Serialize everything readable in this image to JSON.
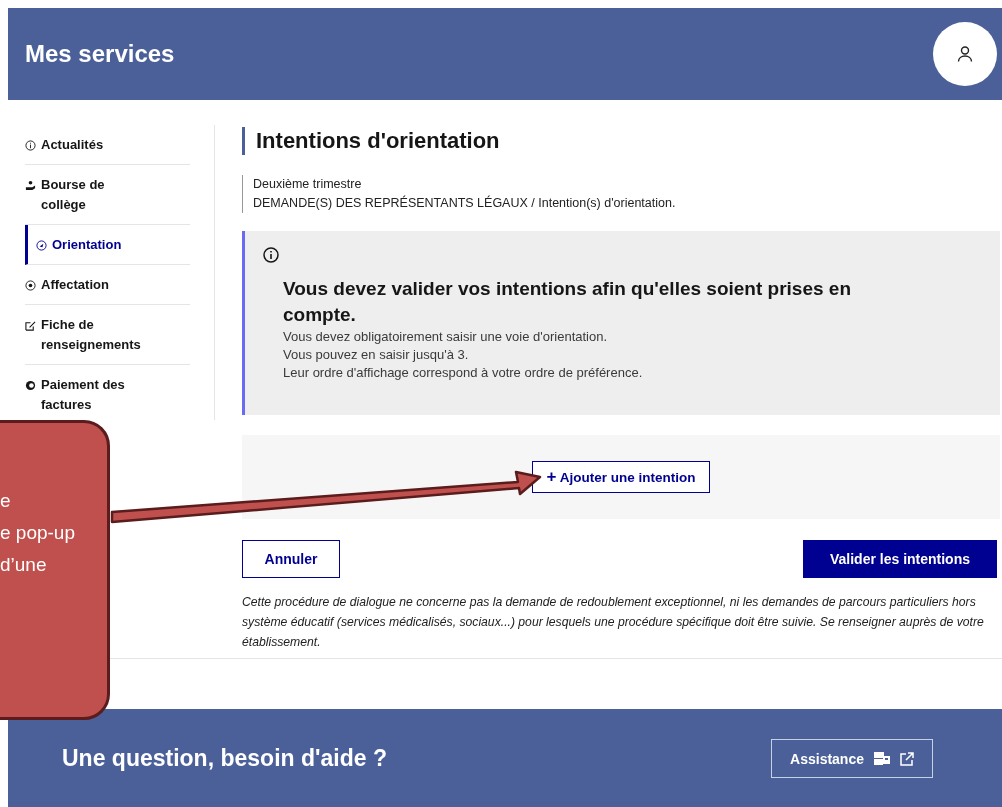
{
  "header": {
    "title": "Mes services"
  },
  "sidebar": {
    "items": [
      {
        "label": "Actualités",
        "selected": false
      },
      {
        "label": "Bourse de collège",
        "selected": false
      },
      {
        "label": "Orientation",
        "selected": true
      },
      {
        "label": "Affectation",
        "selected": false
      },
      {
        "label": "Fiche de renseignements",
        "selected": false
      },
      {
        "label": "Paiement des factures",
        "selected": false
      }
    ]
  },
  "page": {
    "title": "Intentions d'orientation",
    "subtitle_lines": [
      "Deuxième trimestre",
      "DEMANDE(S) DES REPRÉSENTANTS LÉGAUX / Intention(s) d'orientation."
    ]
  },
  "alert": {
    "title": "Vous devez valider vos intentions afin qu'elles soient prises en compte.",
    "lines": [
      "Vous devez obligatoirement saisir une voie d'orientation.",
      "Vous pouvez en saisir jusqu'à 3.",
      "Leur ordre d'affichage correspond à votre ordre de préférence."
    ]
  },
  "add_button": {
    "icon": "+",
    "label": "Ajouter une intention"
  },
  "buttons": {
    "cancel": "Annuler",
    "validate": "Valider les intentions"
  },
  "note": "Cette procédure de dialogue ne concerne pas la demande de redoublement exceptionnel, ni les demandes de parcours particuliers hors système éducatif (services médicalisés, sociaux...) pour lesquels une procédure spécifique doit être suivie. Se renseigner auprès de votre établissement.",
  "footer": {
    "title": "Une question, besoin d'aide ?",
    "assistance": "Assistance"
  },
  "callout": {
    "lines": [
      "e",
      "e pop-up",
      "d’une"
    ]
  }
}
